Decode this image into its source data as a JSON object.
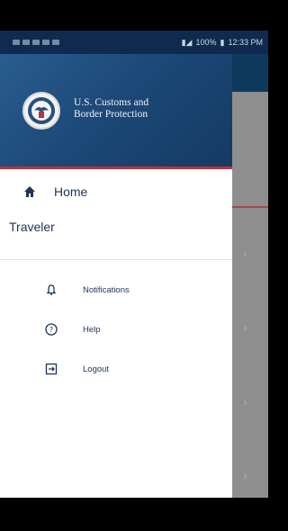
{
  "status_bar": {
    "battery": "100%",
    "time": "12:33 PM"
  },
  "header": {
    "agency_line1": "U.S. Customs and",
    "agency_line2": "Border Protection",
    "accent_color": "#b5343e"
  },
  "nav": {
    "home": {
      "label": "Home",
      "icon": "home-icon"
    }
  },
  "section": {
    "title": "Traveler"
  },
  "menu": [
    {
      "label": "Notifications",
      "icon": "bell-icon"
    },
    {
      "label": "Help",
      "icon": "help-icon"
    },
    {
      "label": "Logout",
      "icon": "logout-icon"
    }
  ],
  "colors": {
    "text": "#1d3557",
    "header_bg": "#1c4978"
  }
}
